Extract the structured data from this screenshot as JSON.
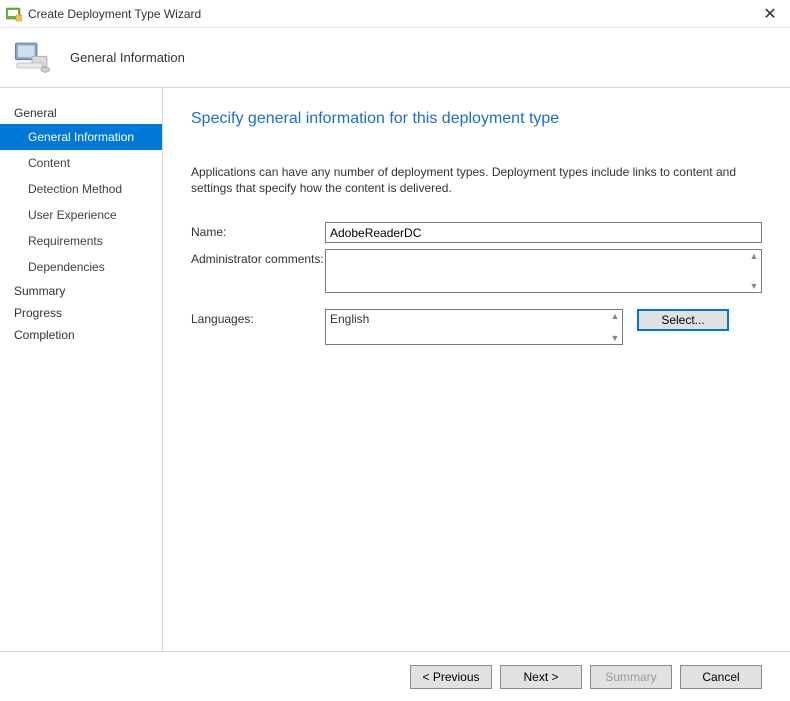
{
  "window": {
    "title": "Create Deployment Type Wizard"
  },
  "header": {
    "step_title": "General Information"
  },
  "sidebar": {
    "groups": [
      {
        "label": "General",
        "items": [
          {
            "label": "General Information",
            "selected": true
          },
          {
            "label": "Content"
          },
          {
            "label": "Detection Method"
          },
          {
            "label": "User Experience"
          },
          {
            "label": "Requirements"
          },
          {
            "label": "Dependencies"
          }
        ]
      },
      {
        "label": "Summary",
        "items": []
      },
      {
        "label": "Progress",
        "items": []
      },
      {
        "label": "Completion",
        "items": []
      }
    ]
  },
  "main": {
    "heading": "Specify general information for this deployment type",
    "description": "Applications can have any number of deployment types. Deployment types include links to content and settings that specify how the content is delivered.",
    "fields": {
      "name_label": "Name:",
      "name_value": "AdobeReaderDC",
      "comments_label": "Administrator comments:",
      "comments_value": "",
      "languages_label": "Languages:",
      "languages_value": "English",
      "select_button": "Select..."
    }
  },
  "footer": {
    "previous": "< Previous",
    "next": "Next >",
    "summary": "Summary",
    "cancel": "Cancel"
  }
}
